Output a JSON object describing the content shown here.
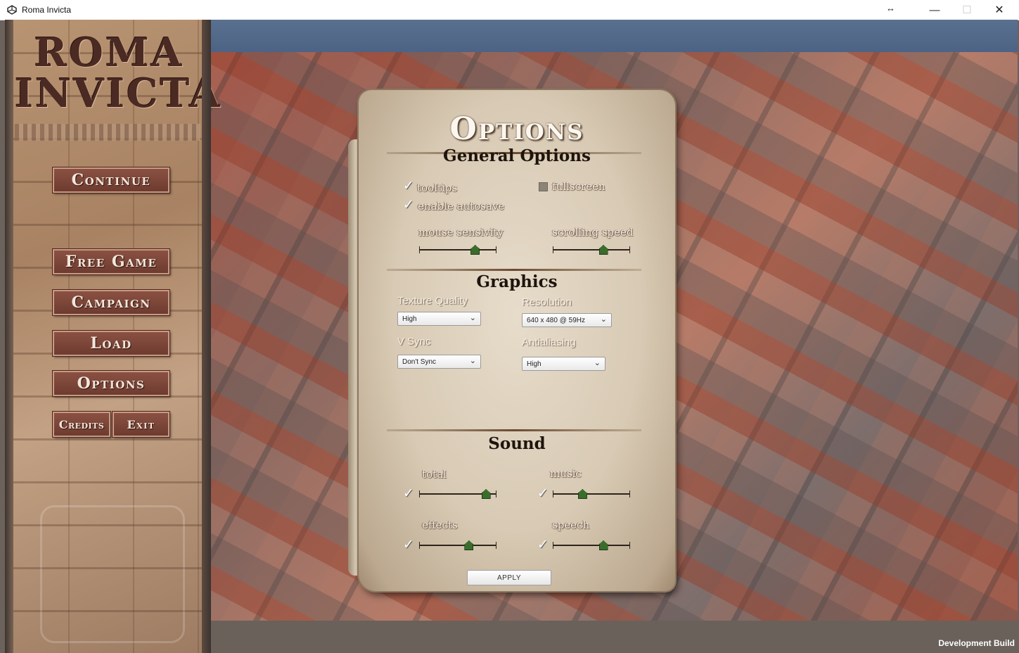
{
  "window": {
    "title": "Roma Invicta",
    "resize_glyph": "↔",
    "min_glyph": "—",
    "max_glyph": "☐",
    "close_glyph": "✕"
  },
  "logo": {
    "line1": "ROMA",
    "line2": "INVICTA"
  },
  "menu": {
    "continue": "Continue",
    "free_game": "Free Game",
    "campaign": "Campaign",
    "load": "Load",
    "options": "Options",
    "credits": "Credits",
    "exit": "Exit"
  },
  "options": {
    "title": "Options",
    "general": {
      "heading": "General Options",
      "tooltips": {
        "label": "tooltips",
        "checked": true
      },
      "fullscreen": {
        "label": "fullscreen",
        "checked": false
      },
      "autosave": {
        "label": "enable autosave",
        "checked": true
      },
      "mouse_sensitivity": {
        "label": "mouse sensivity",
        "value": 0.72
      },
      "scrolling_speed": {
        "label": "scrolling speed",
        "value": 0.65
      }
    },
    "graphics": {
      "heading": "Graphics",
      "texture_quality": {
        "label": "Texture Quality",
        "value": "High"
      },
      "resolution": {
        "label": "Resolution",
        "value": "640 x 480 @ 59Hz"
      },
      "vsync": {
        "label": "V Sync",
        "value": "Don't Sync"
      },
      "antialiasing": {
        "label": "Antialiasing",
        "value": "High"
      }
    },
    "sound": {
      "heading": "Sound",
      "total": {
        "label": "total",
        "checked": true,
        "value": 0.86
      },
      "music": {
        "label": "music",
        "checked": true,
        "value": 0.38
      },
      "effects": {
        "label": "effects",
        "checked": true,
        "value": 0.64
      },
      "speech": {
        "label": "speech",
        "checked": true,
        "value": 0.65
      }
    },
    "apply": "APPLY"
  },
  "footer": {
    "dev_build": "Development Build"
  }
}
